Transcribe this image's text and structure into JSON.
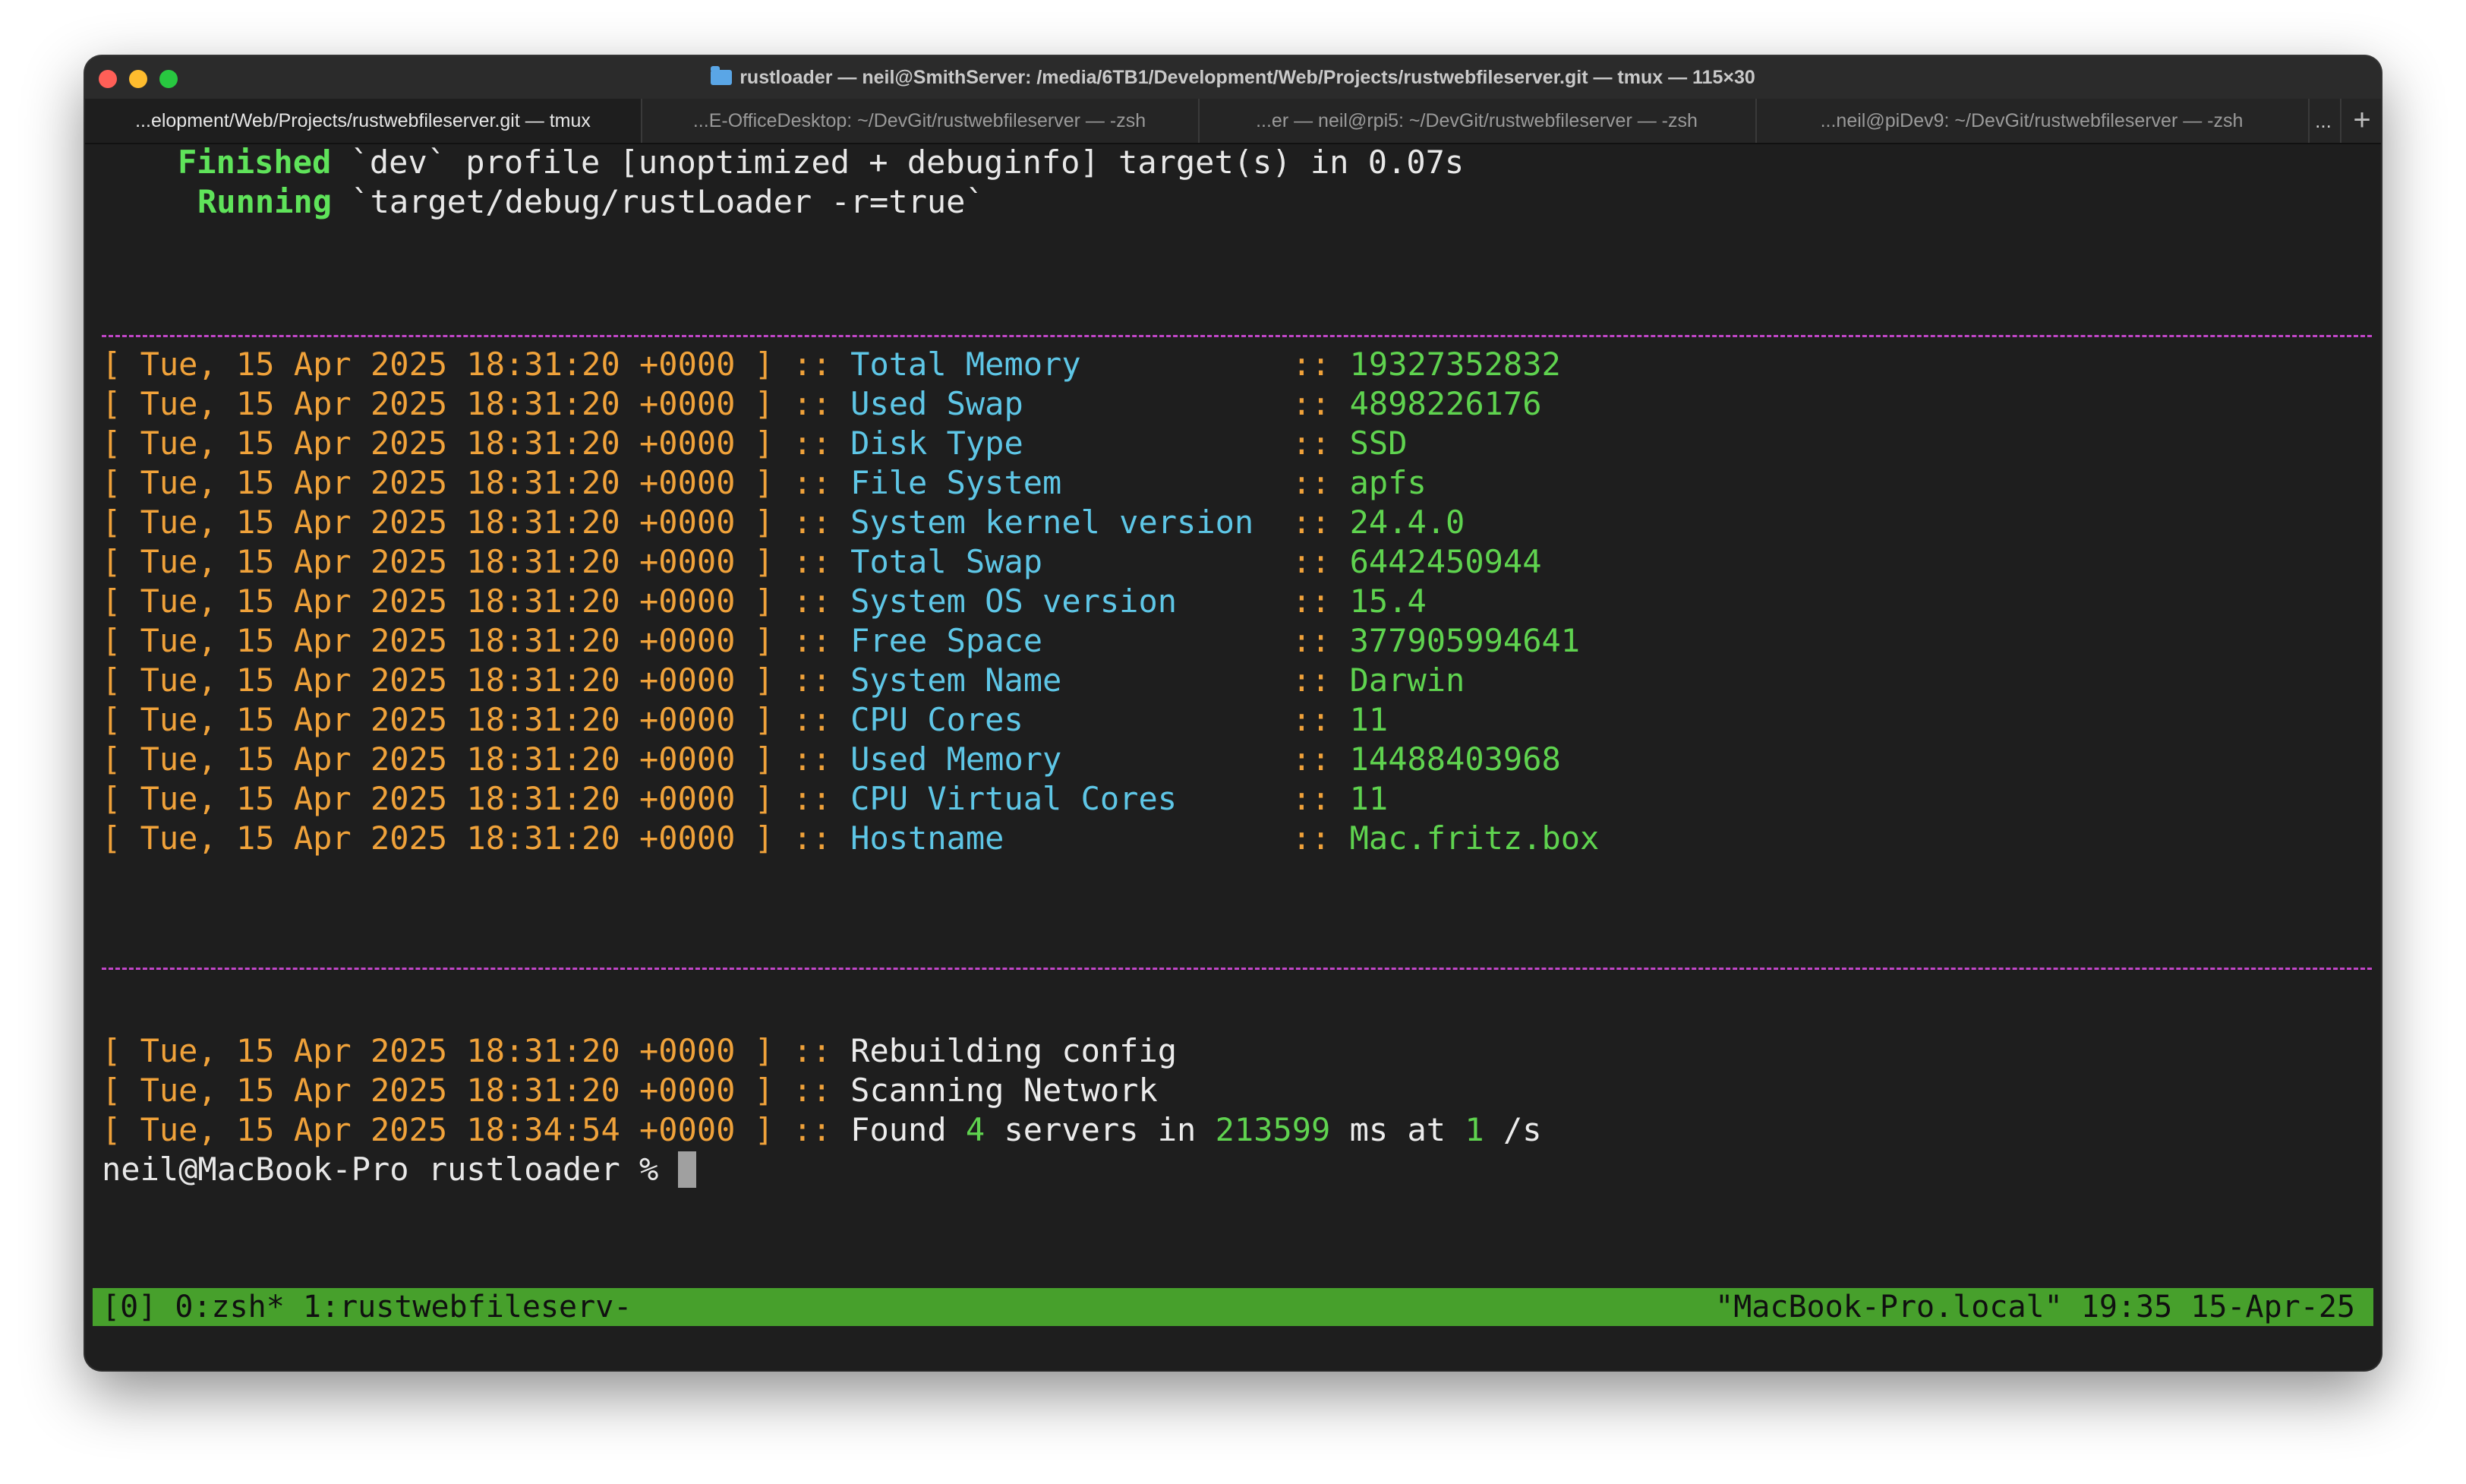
{
  "window": {
    "title": "rustloader — neil@SmithServer: /media/6TB1/Development/Web/Projects/rustwebfileserver.git — tmux — 115×30"
  },
  "tabs": [
    {
      "label": "...elopment/Web/Projects/rustwebfileserver.git — tmux",
      "active": true
    },
    {
      "label": "...E-OfficeDesktop: ~/DevGit/rustwebfileserver — -zsh",
      "active": false
    },
    {
      "label": "...er — neil@rpi5: ~/DevGit/rustwebfileserver — -zsh",
      "active": false
    },
    {
      "label": "...neil@piDev9: ~/DevGit/rustwebfileserver — -zsh",
      "active": false
    }
  ],
  "tab_overflow": "...",
  "tab_add": "+",
  "build": {
    "finished_label": "Finished",
    "finished_text": " `dev` profile [unoptimized + debuginfo] target(s) in 0.07s",
    "running_label": "Running",
    "running_text": " `target/debug/rustLoader -r=true`"
  },
  "info_rows": [
    {
      "ts": "[ Tue, 15 Apr 2025 18:31:20 +0000 ]",
      "sep": " :: ",
      "key": "Total Memory          ",
      "sep2": " :: ",
      "value": "19327352832"
    },
    {
      "ts": "[ Tue, 15 Apr 2025 18:31:20 +0000 ]",
      "sep": " :: ",
      "key": "Used Swap             ",
      "sep2": " :: ",
      "value": "4898226176"
    },
    {
      "ts": "[ Tue, 15 Apr 2025 18:31:20 +0000 ]",
      "sep": " :: ",
      "key": "Disk Type             ",
      "sep2": " :: ",
      "value": "SSD"
    },
    {
      "ts": "[ Tue, 15 Apr 2025 18:31:20 +0000 ]",
      "sep": " :: ",
      "key": "File System           ",
      "sep2": " :: ",
      "value": "apfs"
    },
    {
      "ts": "[ Tue, 15 Apr 2025 18:31:20 +0000 ]",
      "sep": " :: ",
      "key": "System kernel version ",
      "sep2": " :: ",
      "value": "24.4.0"
    },
    {
      "ts": "[ Tue, 15 Apr 2025 18:31:20 +0000 ]",
      "sep": " :: ",
      "key": "Total Swap            ",
      "sep2": " :: ",
      "value": "6442450944"
    },
    {
      "ts": "[ Tue, 15 Apr 2025 18:31:20 +0000 ]",
      "sep": " :: ",
      "key": "System OS version     ",
      "sep2": " :: ",
      "value": "15.4"
    },
    {
      "ts": "[ Tue, 15 Apr 2025 18:31:20 +0000 ]",
      "sep": " :: ",
      "key": "Free Space            ",
      "sep2": " :: ",
      "value": "377905994641"
    },
    {
      "ts": "[ Tue, 15 Apr 2025 18:31:20 +0000 ]",
      "sep": " :: ",
      "key": "System Name           ",
      "sep2": " :: ",
      "value": "Darwin"
    },
    {
      "ts": "[ Tue, 15 Apr 2025 18:31:20 +0000 ]",
      "sep": " :: ",
      "key": "CPU Cores             ",
      "sep2": " :: ",
      "value": "11"
    },
    {
      "ts": "[ Tue, 15 Apr 2025 18:31:20 +0000 ]",
      "sep": " :: ",
      "key": "Used Memory           ",
      "sep2": " :: ",
      "value": "14488403968"
    },
    {
      "ts": "[ Tue, 15 Apr 2025 18:31:20 +0000 ]",
      "sep": " :: ",
      "key": "CPU Virtual Cores     ",
      "sep2": " :: ",
      "value": "11"
    },
    {
      "ts": "[ Tue, 15 Apr 2025 18:31:20 +0000 ]",
      "sep": " :: ",
      "key": "Hostname              ",
      "sep2": " :: ",
      "value": "Mac.fritz.box"
    }
  ],
  "log_rows": [
    {
      "ts": "[ Tue, 15 Apr 2025 18:31:20 +0000 ]",
      "sep": " :: ",
      "text": "Rebuilding config"
    },
    {
      "ts": "[ Tue, 15 Apr 2025 18:31:20 +0000 ]",
      "sep": " :: ",
      "text": "Scanning Network"
    }
  ],
  "found_row": {
    "ts": "[ Tue, 15 Apr 2025 18:34:54 +0000 ]",
    "sep": " :: ",
    "t1": "Found ",
    "servers": "4",
    "t2": " servers in ",
    "ms": "213599",
    "t3": " ms at ",
    "rate": "1",
    "t4": " /s"
  },
  "prompt": "neil@MacBook-Pro rustloader % ",
  "status": {
    "left": "[0] 0:zsh* 1:rustwebfileserv-",
    "right": "\"MacBook-Pro.local\" 19:35 15-Apr-25"
  },
  "colors": {
    "timestamp": "#f0a23a",
    "key": "#5ec6e6",
    "value": "#5fd34f",
    "separator_line": "#c045c7",
    "status_bar": "#47a02c"
  }
}
